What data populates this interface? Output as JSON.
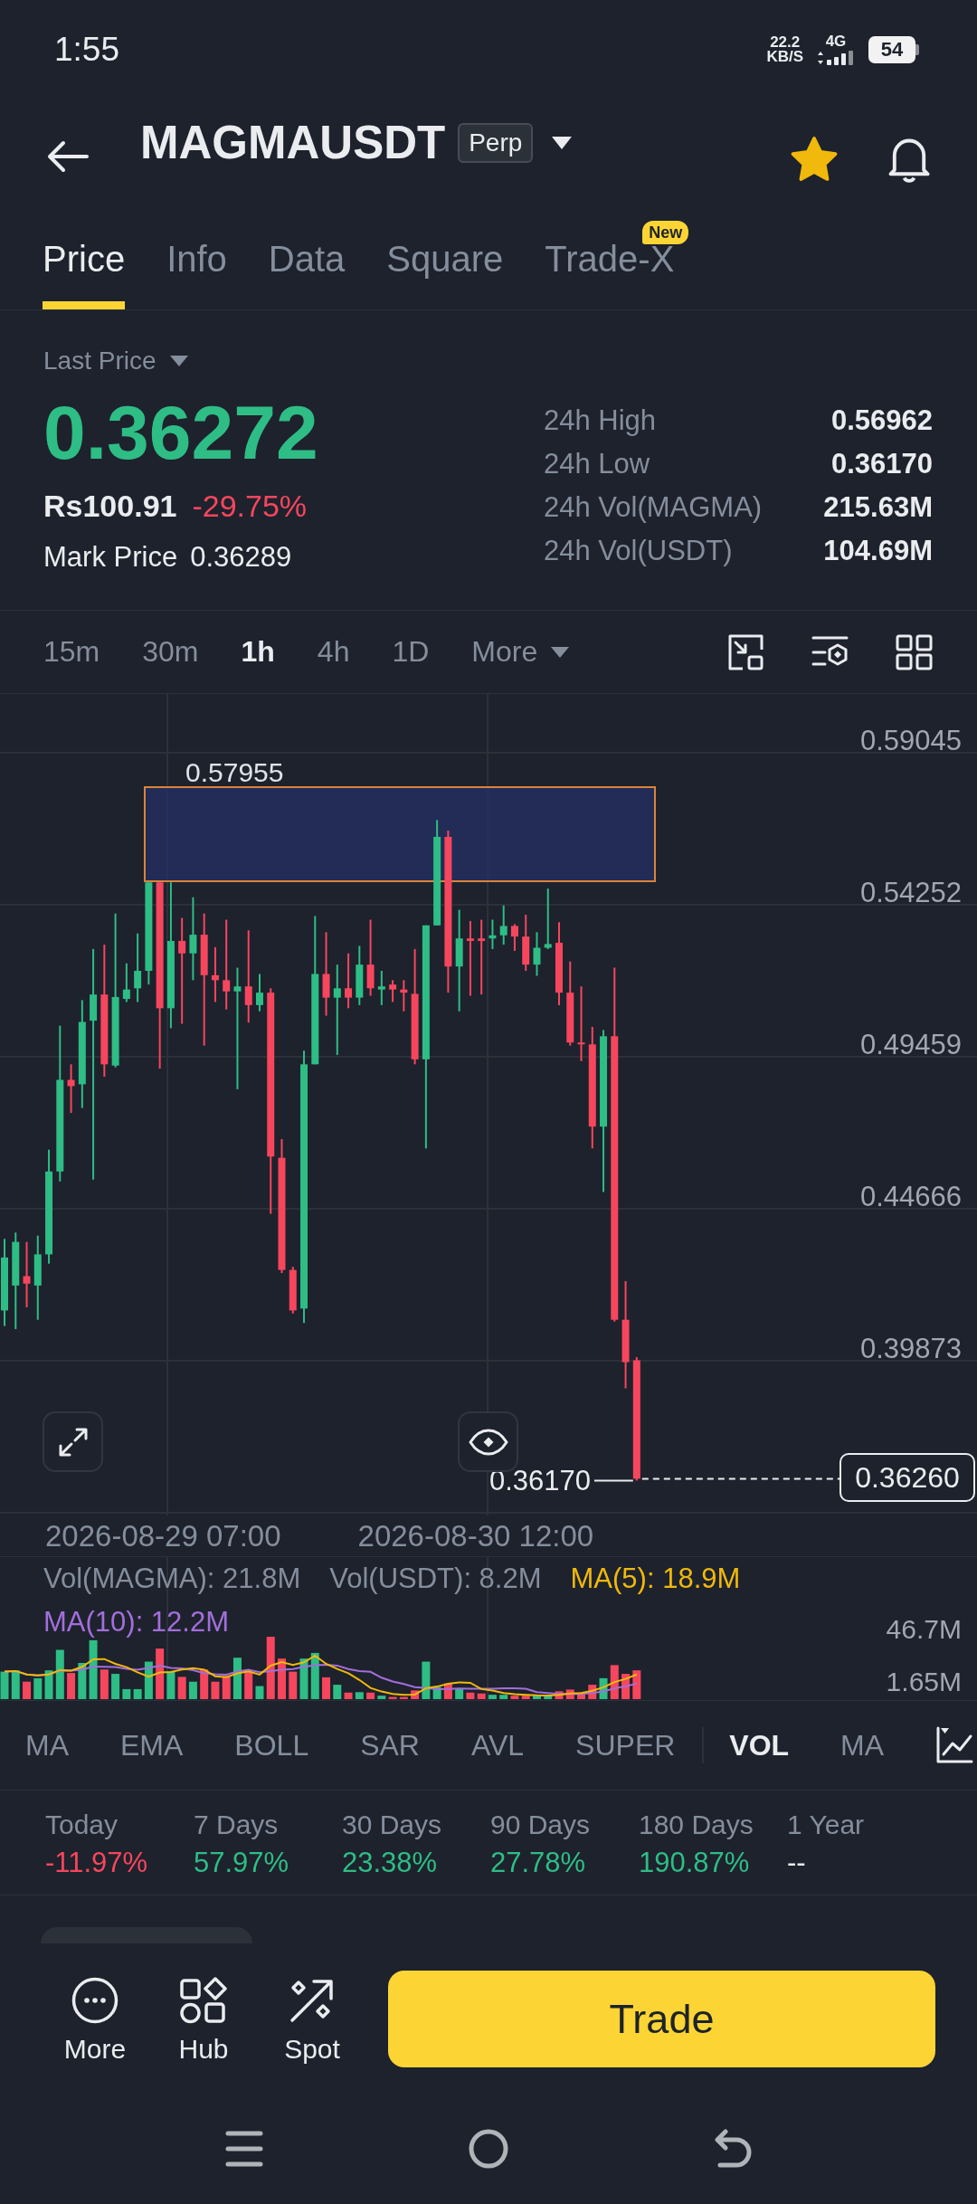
{
  "status_bar": {
    "time": "1:55",
    "speed": "22.2",
    "speed_unit": "KB/S",
    "network": "4G",
    "battery": "54"
  },
  "header": {
    "title": "MAGMAUSDT",
    "badge": "Perp",
    "favorite": true
  },
  "tabs": [
    {
      "label": "Price",
      "selected": true
    },
    {
      "label": "Info",
      "selected": false
    },
    {
      "label": "Data",
      "selected": false
    },
    {
      "label": "Square",
      "selected": false
    },
    {
      "label": "Trade-X",
      "selected": false,
      "badge": "New"
    }
  ],
  "price": {
    "label": "Last Price",
    "value": "0.36272",
    "fiat": "Rs100.91",
    "change": "-29.75%",
    "mark_label": "Mark Price",
    "mark_value": "0.36289"
  },
  "stats": [
    {
      "label": "24h High",
      "value": "0.56962"
    },
    {
      "label": "24h Low",
      "value": "0.36170"
    },
    {
      "label": "24h Vol(MAGMA)",
      "value": "215.63M"
    },
    {
      "label": "24h Vol(USDT)",
      "value": "104.69M"
    }
  ],
  "intervals": [
    {
      "label": "15m",
      "kind": "interval",
      "selected": false
    },
    {
      "label": "30m",
      "kind": "interval",
      "selected": false
    },
    {
      "label": "1h",
      "kind": "interval",
      "selected": true
    },
    {
      "label": "4h",
      "kind": "interval",
      "selected": false
    },
    {
      "label": "1D",
      "kind": "interval",
      "selected": false
    },
    {
      "label": "More",
      "kind": "menu",
      "selected": false
    }
  ],
  "chart": {
    "price_axis": [
      "0.59045",
      "0.54252",
      "0.49459",
      "0.44666",
      "0.39873"
    ],
    "zone_label": "0.57955",
    "low_label": "0.36170",
    "current_price": "0.36260",
    "time_axis": [
      "2026-08-29 07:00",
      "2026-08-30 12:00"
    ]
  },
  "volume": {
    "labels": [
      {
        "text": "Vol(MAGMA): 21.8M",
        "color": "#848e9c"
      },
      {
        "text": "Vol(USDT): 8.2M",
        "color": "#848e9c"
      },
      {
        "text": "MA(5): 18.9M",
        "color": "#f0b90b"
      },
      {
        "text": "MA(10): 12.2M",
        "color": "#a26fdb"
      }
    ],
    "axis": [
      "46.7M",
      "1.65M"
    ]
  },
  "indicators": [
    {
      "label": "MA",
      "kind": "main",
      "selected": false
    },
    {
      "label": "EMA",
      "kind": "main",
      "selected": false
    },
    {
      "label": "BOLL",
      "kind": "main",
      "selected": false
    },
    {
      "label": "SAR",
      "kind": "main",
      "selected": false
    },
    {
      "label": "AVL",
      "kind": "main",
      "selected": false
    },
    {
      "label": "SUPER",
      "kind": "main",
      "selected": false
    },
    {
      "label": "VOL",
      "kind": "sub",
      "selected": true
    },
    {
      "label": "MA",
      "kind": "sub",
      "selected": false
    }
  ],
  "performance": [
    {
      "label": "Today",
      "value": "-11.97%",
      "color": "#f6465d"
    },
    {
      "label": "7 Days",
      "value": "57.97%",
      "color": "#2ebd85"
    },
    {
      "label": "30 Days",
      "value": "23.38%",
      "color": "#2ebd85"
    },
    {
      "label": "90 Days",
      "value": "27.78%",
      "color": "#2ebd85"
    },
    {
      "label": "180 Days",
      "value": "190.87%",
      "color": "#2ebd85"
    },
    {
      "label": "1 Year",
      "value": "--",
      "color": "#eaecef"
    }
  ],
  "actions": [
    {
      "kind": "more",
      "label": "More"
    },
    {
      "kind": "hub",
      "label": "Hub"
    },
    {
      "kind": "spot",
      "label": "Spot"
    }
  ],
  "trade_button": "Trade"
}
